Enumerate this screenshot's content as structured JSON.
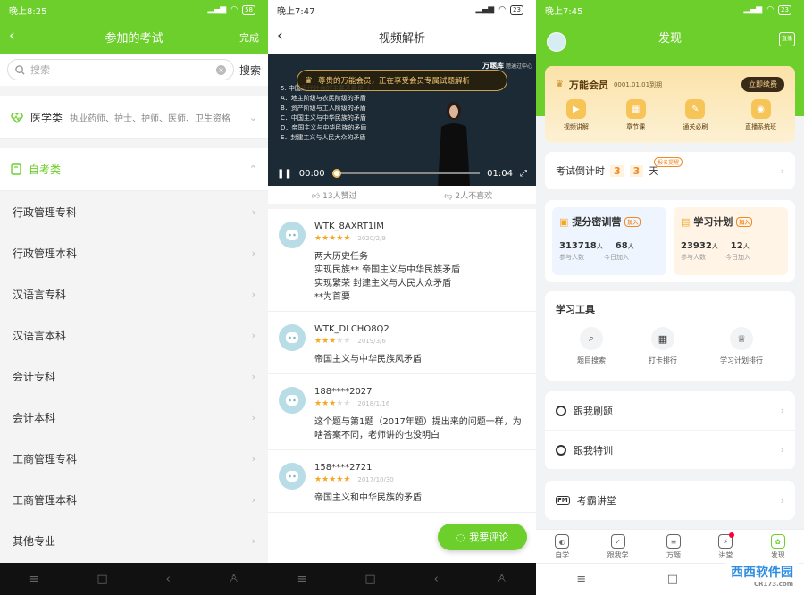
{
  "panel1": {
    "status": {
      "time": "晚上8:25",
      "battery": "58"
    },
    "nav": {
      "back": "‹",
      "title": "参加的考试",
      "done": "完成"
    },
    "search": {
      "placeholder": "搜索",
      "button": "搜索"
    },
    "medical": {
      "title": "医学类",
      "sub": "执业药师、护士、护师、医师、卫生资格"
    },
    "selfstudy": {
      "title": "自考类"
    },
    "items": [
      "行政管理专科",
      "行政管理本科",
      "汉语言专科",
      "汉语言本科",
      "会计专科",
      "会计本科",
      "工商管理专科",
      "工商管理本科",
      "其他专业"
    ],
    "colors": {
      "accent": "#6ccf2b"
    }
  },
  "panel2": {
    "status": {
      "time": "晚上7:47",
      "battery": "23"
    },
    "nav": {
      "back": "‹",
      "title": "视频解析"
    },
    "video": {
      "banner": "尊贵的万能会员，正在享受会员专属试题解析",
      "brand": "万题库",
      "brand2": "题通过中心",
      "question": "5. 中国近代社会的主要矛盾是（  ）",
      "options": [
        "A．地主阶级与农民阶级的矛盾",
        "B．资产阶级与工人阶级的矛盾",
        "C．中国主义与中华民族的矛盾",
        "D．帝国主义与中华民族的矛盾",
        "E．封建主义与人民大众的矛盾"
      ],
      "time_start": "00:00",
      "time_end": "01:04",
      "progress": 0
    },
    "votes": {
      "like": "13人赞过",
      "dislike": "2人不喜欢"
    },
    "comments": [
      {
        "name": "WTK_8AXRT1IM",
        "stars": 5,
        "date": "2020/2/9",
        "text": "两大历史任务\n实现民族** 帝国主义与中华民族矛盾\n实现繁荣 封建主义与人民大众矛盾\n**为首要"
      },
      {
        "name": "WTK_DLCHO8Q2",
        "stars": 3,
        "date": "2019/3/6",
        "text": "帝国主义与中华民族风矛盾"
      },
      {
        "name": "188****2027",
        "stars": 3,
        "date": "2018/1/16",
        "text": "这个题与第1题（2017年题）提出来的问题一样，为啥答案不同，老师讲的也没明白"
      },
      {
        "name": "158****2721",
        "stars": 5,
        "date": "2017/10/30",
        "text": "帝国主义和中华民族的矛盾"
      }
    ],
    "fab": "我要评论"
  },
  "panel3": {
    "status": {
      "time": "晚上7:45",
      "battery": "23"
    },
    "nav": {
      "title": "发现",
      "live": "直播"
    },
    "vip": {
      "title": "万能会员",
      "date": "0001.01.01到期",
      "renew": "立即续费",
      "items": [
        "视频讲解",
        "章节课",
        "通关必刷",
        "直播系统班"
      ]
    },
    "countdown": {
      "label": "考试倒计时",
      "d1": "3",
      "d2": "3",
      "unit": "天",
      "tag": "报名提醒"
    },
    "camp": {
      "title": "提分密训营",
      "tag": "加入",
      "n1": "313718",
      "u1": "人",
      "n2": "68",
      "u2": "人",
      "l1": "参与人数",
      "l2": "今日加入"
    },
    "plan": {
      "title": "学习计划",
      "tag": "加入",
      "n1": "23932",
      "u1": "人",
      "n2": "12",
      "u2": "人",
      "l1": "参与人数",
      "l2": "今日加入"
    },
    "tools": {
      "title": "学习工具",
      "items": [
        "题目搜索",
        "打卡排行",
        "学习计划排行"
      ]
    },
    "follow": [
      "跟我刷题",
      "跟我特训"
    ],
    "lecture": "考霸讲堂",
    "tabs": [
      "自学",
      "跟我学",
      "万题",
      "讲堂",
      "发现"
    ],
    "watermark": "西西软件园",
    "watermark_sub": "CR173.com"
  }
}
